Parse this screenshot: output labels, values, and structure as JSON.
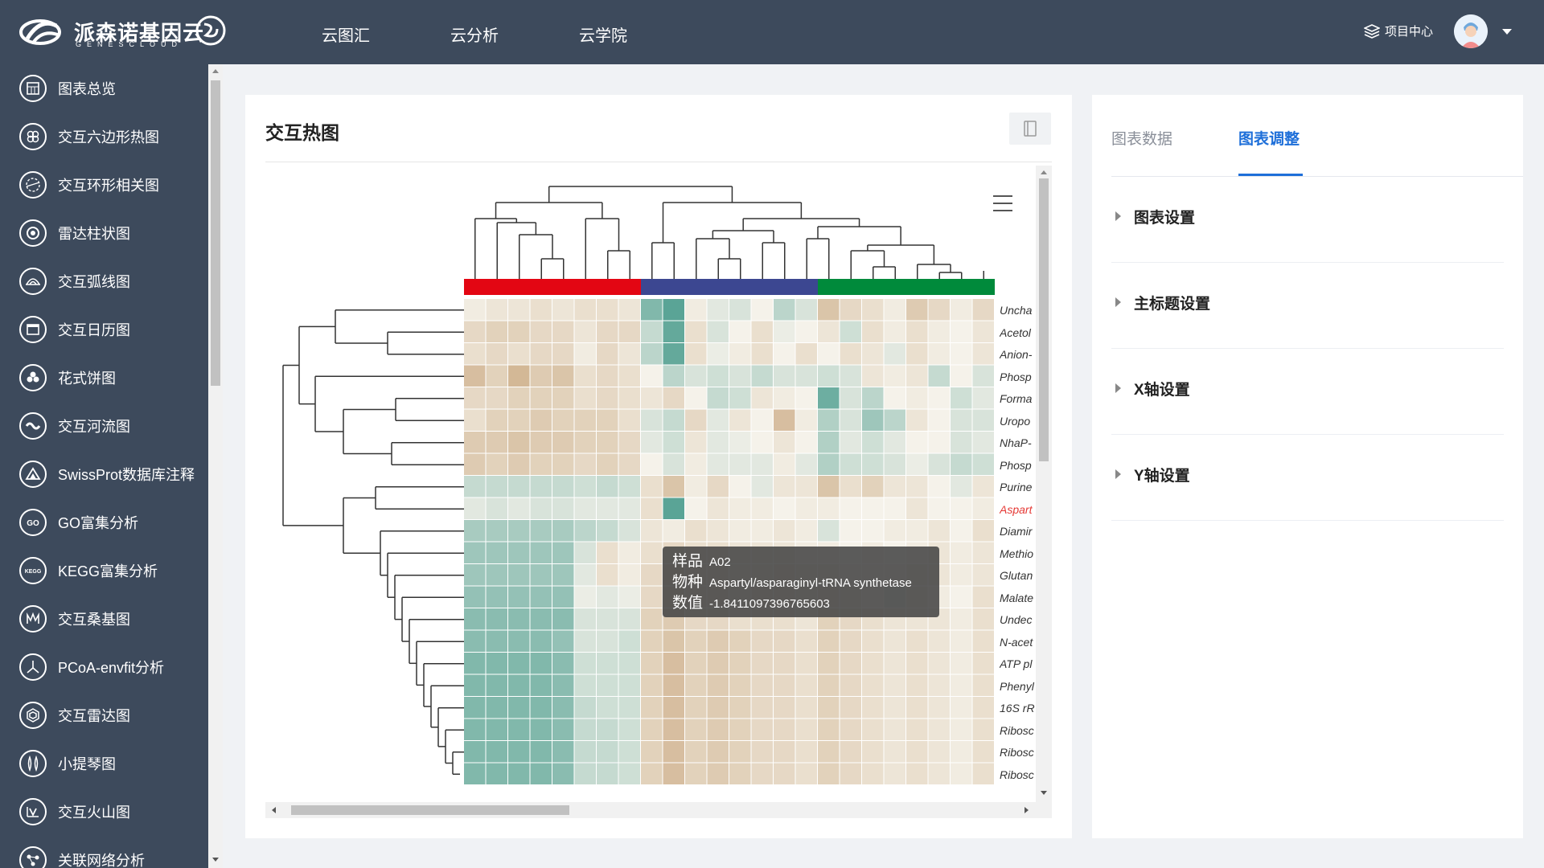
{
  "app": {
    "name": "派森诺基因云",
    "subname": "GENESCLOUD"
  },
  "topnav": [
    {
      "label": "云图汇"
    },
    {
      "label": "云分析"
    },
    {
      "label": "云学院"
    }
  ],
  "user": {
    "project_center": "项目中心"
  },
  "sidebar": {
    "items": [
      {
        "label": "图表总览",
        "icon": "grid-icon"
      },
      {
        "label": "交互六边形热图",
        "icon": "hexagon-icon"
      },
      {
        "label": "交互环形相关图",
        "icon": "circle-correlation-icon"
      },
      {
        "label": "雷达柱状图",
        "icon": "radar-bar-icon"
      },
      {
        "label": "交互弧线图",
        "icon": "arc-icon"
      },
      {
        "label": "交互日历图",
        "icon": "calendar-icon"
      },
      {
        "label": "花式饼图",
        "icon": "flower-pie-icon"
      },
      {
        "label": "交互河流图",
        "icon": "river-icon"
      },
      {
        "label": "SwissProt数据库注释",
        "icon": "mountain-icon"
      },
      {
        "label": "GO富集分析",
        "icon": "go-icon"
      },
      {
        "label": "KEGG富集分析",
        "icon": "kegg-icon"
      },
      {
        "label": "交互桑基图",
        "icon": "sankey-icon"
      },
      {
        "label": "PCoA-envfit分析",
        "icon": "pcoa-icon"
      },
      {
        "label": "交互雷达图",
        "icon": "radar-icon"
      },
      {
        "label": "小提琴图",
        "icon": "violin-icon"
      },
      {
        "label": "交互火山图",
        "icon": "volcano-icon"
      },
      {
        "label": "关联网络分析",
        "icon": "network-icon"
      }
    ]
  },
  "main": {
    "title": "交互热图",
    "row_labels": [
      "Uncha",
      "Acetol",
      "Anion-",
      "Phosp",
      "Forma",
      "Uropo",
      "NhaP-",
      "Phosp",
      "Purine",
      "Aspart",
      "Diamir",
      "Methio",
      "Glutan",
      "Malate",
      "Undec",
      "N-acet",
      "ATP pl",
      "Phenyl",
      "16S rR",
      "Ribosc",
      "Ribosc",
      "Ribosc"
    ],
    "highlighted_row": 9,
    "tooltip": {
      "sample_key": "样品",
      "sample_value": "A02",
      "species_key": "物种",
      "species_value": "Aspartyl/asparaginyl-tRNA synthetase",
      "value_key": "数值",
      "value_value": "-1.8411097396765603"
    }
  },
  "right": {
    "tabs": [
      {
        "label": "图表数据",
        "active": false
      },
      {
        "label": "图表调整",
        "active": true
      }
    ],
    "settings": [
      {
        "label": "图表设置"
      },
      {
        "label": "主标题设置"
      },
      {
        "label": "X轴设置"
      },
      {
        "label": "Y轴设置"
      }
    ]
  },
  "chart_data": {
    "type": "heatmap",
    "group_colors": [
      "#e30613",
      "#3c4791",
      "#008a3b"
    ],
    "columns_per_group": 8,
    "color_low": "#5aa496",
    "color_mid": "#f5f2ea",
    "color_high": "#b88a55",
    "values": [
      [
        0.1,
        0.2,
        0.2,
        0.3,
        0.2,
        0.3,
        0.3,
        0.2,
        -1.2,
        -1.6,
        0.1,
        -0.2,
        -0.3,
        0.0,
        -0.6,
        -0.3,
        0.7,
        0.4,
        0.3,
        0.1,
        0.6,
        0.4,
        0.1,
        0.4
      ],
      [
        0.4,
        0.5,
        0.5,
        0.4,
        0.4,
        0.2,
        0.4,
        0.4,
        -0.5,
        -1.5,
        0.3,
        -0.3,
        0.0,
        0.3,
        -0.1,
        0.0,
        0.2,
        -0.4,
        0.3,
        0.1,
        0.3,
        0.1,
        0.0,
        0.2
      ],
      [
        0.3,
        0.4,
        0.3,
        0.4,
        0.4,
        0.1,
        0.4,
        0.2,
        -0.6,
        -1.5,
        0.3,
        -0.1,
        0.1,
        0.3,
        0.0,
        0.3,
        0.0,
        0.3,
        0.2,
        -0.2,
        0.3,
        0.1,
        0.0,
        0.2
      ],
      [
        0.8,
        0.5,
        0.9,
        0.6,
        0.7,
        0.3,
        0.4,
        0.3,
        0.0,
        -0.6,
        -0.3,
        -0.4,
        -0.3,
        -0.5,
        -0.3,
        -0.3,
        -0.4,
        -0.3,
        0.2,
        0.1,
        0.2,
        -0.5,
        0.0,
        -0.3
      ],
      [
        0.4,
        0.4,
        0.5,
        0.5,
        0.5,
        0.3,
        0.4,
        0.3,
        0.2,
        0.4,
        0.0,
        -0.5,
        -0.4,
        0.2,
        0.1,
        0.0,
        -1.4,
        -0.3,
        -0.6,
        0.0,
        0.1,
        0.0,
        -0.4,
        -0.2
      ],
      [
        0.3,
        0.5,
        0.5,
        0.6,
        0.5,
        0.5,
        0.5,
        0.3,
        -0.3,
        -0.5,
        0.4,
        -0.2,
        0.2,
        0.0,
        0.8,
        0.1,
        -0.7,
        -0.3,
        -0.9,
        -0.6,
        0.2,
        0.0,
        -0.3,
        -0.3
      ],
      [
        0.6,
        0.6,
        0.7,
        0.6,
        0.6,
        0.5,
        0.5,
        0.4,
        -0.2,
        -0.4,
        0.2,
        -0.2,
        -0.1,
        0.0,
        0.2,
        0.0,
        -0.7,
        -0.2,
        -0.4,
        -0.2,
        0.0,
        0.0,
        -0.3,
        -0.2
      ],
      [
        0.6,
        0.5,
        0.6,
        0.5,
        0.5,
        0.4,
        0.5,
        0.4,
        0.0,
        -0.3,
        0.1,
        -0.2,
        -0.2,
        -0.2,
        0.1,
        -0.2,
        -0.7,
        -0.4,
        -0.4,
        -0.3,
        -0.1,
        -0.3,
        -0.5,
        -0.4
      ],
      [
        -0.5,
        -0.5,
        -0.5,
        -0.5,
        -0.5,
        -0.4,
        -0.5,
        -0.4,
        0.3,
        0.7,
        0.1,
        0.4,
        0.0,
        -0.2,
        0.2,
        0.2,
        0.7,
        0.3,
        0.5,
        0.2,
        0.2,
        0.0,
        -0.2,
        0.2
      ],
      [
        -0.2,
        -0.3,
        -0.2,
        -0.3,
        -0.3,
        -0.2,
        -0.2,
        -0.2,
        0.3,
        -1.8,
        0.0,
        0.2,
        0.1,
        0.1,
        0.0,
        0.1,
        0.1,
        0.0,
        0.0,
        0.0,
        0.2,
        0.0,
        0.0,
        0.1
      ],
      [
        -0.8,
        -0.8,
        -0.8,
        -0.8,
        -0.8,
        -0.6,
        -0.5,
        -0.3,
        0.2,
        0.1,
        0.3,
        0.2,
        0.1,
        0.1,
        0.2,
        0.1,
        -0.3,
        0.0,
        0.0,
        0.1,
        0.1,
        0.2,
        0.0,
        0.3
      ],
      [
        -0.9,
        -0.9,
        -0.9,
        -0.9,
        -0.9,
        -0.3,
        0.3,
        0.1,
        0.3,
        0.4,
        0.3,
        0.3,
        0.2,
        0.2,
        0.2,
        0.1,
        0.1,
        0.0,
        0.1,
        0.0,
        0.1,
        0.2,
        0.1,
        0.2
      ],
      [
        -0.9,
        -0.9,
        -0.9,
        -0.9,
        -0.9,
        -0.2,
        0.3,
        0.1,
        0.4,
        0.5,
        0.3,
        0.3,
        0.2,
        0.2,
        0.3,
        0.2,
        0.2,
        0.1,
        0.1,
        0.1,
        0.2,
        0.2,
        0.1,
        0.2
      ],
      [
        -1.0,
        -1.0,
        -1.0,
        -1.0,
        -1.0,
        -0.1,
        -0.2,
        -0.1,
        0.4,
        0.5,
        0.3,
        0.3,
        0.2,
        0.3,
        0.3,
        0.2,
        0.3,
        0.2,
        0.1,
        -0.3,
        0.2,
        0.1,
        0.0,
        0.3
      ],
      [
        -1.1,
        -1.1,
        -1.1,
        -1.1,
        -1.1,
        -0.3,
        -0.3,
        -0.3,
        0.5,
        0.6,
        0.4,
        0.4,
        0.3,
        0.3,
        0.3,
        0.2,
        0.5,
        0.4,
        0.3,
        0.2,
        0.2,
        0.2,
        0.1,
        0.3
      ],
      [
        -1.1,
        -1.1,
        -1.1,
        -1.1,
        -1.0,
        -0.3,
        -0.3,
        -0.4,
        0.5,
        0.7,
        0.5,
        0.6,
        0.5,
        0.4,
        0.4,
        0.3,
        0.5,
        0.4,
        0.3,
        0.2,
        0.3,
        0.2,
        0.1,
        0.3
      ],
      [
        -1.2,
        -1.2,
        -1.2,
        -1.2,
        -1.1,
        -0.4,
        -0.4,
        -0.4,
        0.5,
        0.8,
        0.5,
        0.6,
        0.5,
        0.4,
        0.4,
        0.3,
        0.5,
        0.4,
        0.3,
        0.2,
        0.3,
        0.2,
        0.1,
        0.3
      ],
      [
        -1.2,
        -1.2,
        -1.2,
        -1.2,
        -1.1,
        -0.4,
        -0.4,
        -0.4,
        0.5,
        0.8,
        0.5,
        0.6,
        0.5,
        0.4,
        0.4,
        0.3,
        0.5,
        0.4,
        0.3,
        0.2,
        0.3,
        0.2,
        0.1,
        0.3
      ],
      [
        -1.2,
        -1.2,
        -1.2,
        -1.2,
        -1.1,
        -0.5,
        -0.4,
        -0.4,
        0.5,
        0.8,
        0.5,
        0.6,
        0.5,
        0.4,
        0.4,
        0.3,
        0.5,
        0.4,
        0.3,
        0.2,
        0.3,
        0.2,
        0.1,
        0.3
      ],
      [
        -1.2,
        -1.2,
        -1.2,
        -1.2,
        -1.1,
        -0.5,
        -0.5,
        -0.4,
        0.5,
        0.8,
        0.5,
        0.6,
        0.5,
        0.4,
        0.4,
        0.3,
        0.5,
        0.4,
        0.3,
        0.2,
        0.3,
        0.2,
        0.1,
        0.3
      ],
      [
        -1.2,
        -1.2,
        -1.2,
        -1.2,
        -1.1,
        -0.5,
        -0.5,
        -0.4,
        0.5,
        0.8,
        0.5,
        0.6,
        0.5,
        0.4,
        0.4,
        0.3,
        0.5,
        0.4,
        0.3,
        0.2,
        0.3,
        0.2,
        0.1,
        0.3
      ],
      [
        -1.2,
        -1.2,
        -1.2,
        -1.2,
        -1.1,
        -0.5,
        -0.5,
        -0.4,
        0.5,
        0.8,
        0.5,
        0.6,
        0.5,
        0.4,
        0.4,
        0.3,
        0.5,
        0.4,
        0.3,
        0.2,
        0.3,
        0.2,
        0.1,
        0.3
      ]
    ]
  }
}
